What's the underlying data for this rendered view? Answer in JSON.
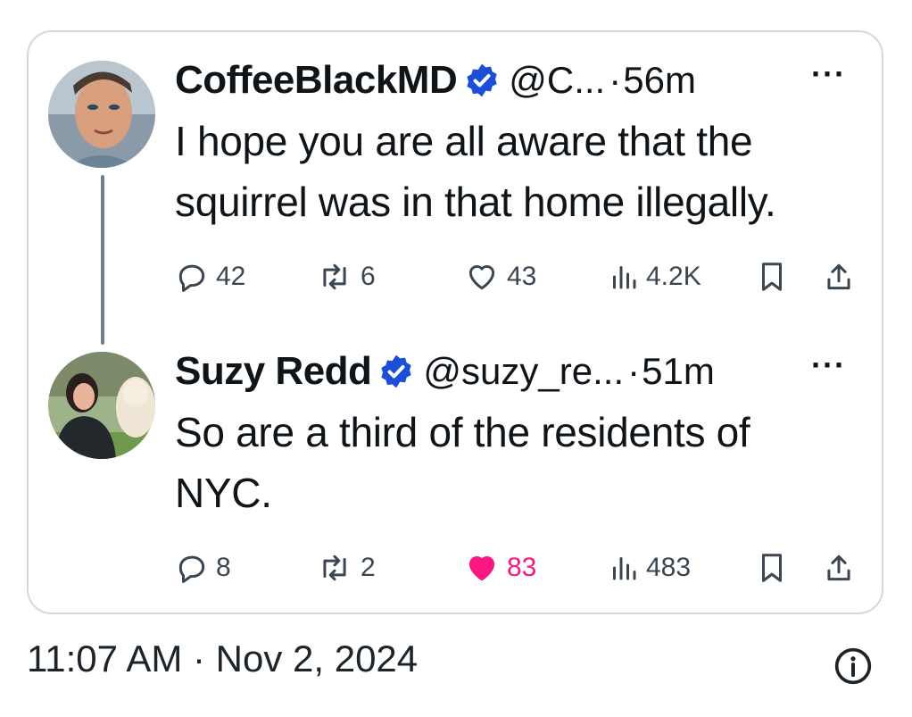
{
  "tweets": [
    {
      "name": "CoffeeBlackMD",
      "handle": "@C...",
      "separator": "·",
      "time": "56m",
      "more": "···",
      "text_lines": [
        "I hope you are all aware that the",
        "squirrel was in that home illegally."
      ],
      "replies": "42",
      "reposts": "6",
      "likes": "43",
      "liked": false,
      "views": "4.2K"
    },
    {
      "name": "Suzy Redd",
      "handle": "@suzy_re...",
      "separator": "·",
      "time": "51m",
      "more": "···",
      "text_lines": [
        "So are a third of the residents of",
        "NYC."
      ],
      "replies": "8",
      "reposts": "2",
      "likes": "83",
      "liked": true,
      "views": "483"
    }
  ],
  "footer": {
    "timestamp": "11:07 AM · Nov 2, 2024"
  },
  "colors": {
    "verified": "#1d4ed8",
    "like_active": "#f91880",
    "thread_line": "#6f7f8c",
    "border": "#cfd9de"
  },
  "icons": [
    "reply-icon",
    "repost-icon",
    "like-icon",
    "views-icon",
    "bookmark-icon",
    "share-icon",
    "verified-badge-icon",
    "info-icon"
  ]
}
